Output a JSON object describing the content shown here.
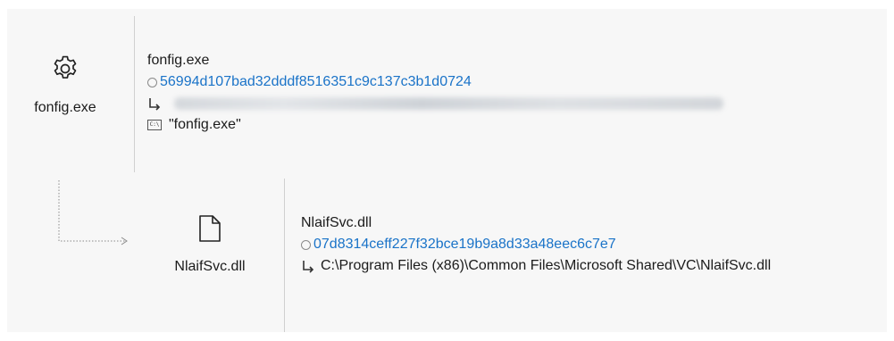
{
  "process": {
    "icon": "gear-icon",
    "label": "fonfig.exe",
    "name": "fonfig.exe",
    "hash": "56994d107bad32dddf8516351c9c137c3b1d0724",
    "command_line": "\"fonfig.exe\""
  },
  "loaded_file": {
    "icon": "file-icon",
    "label": "NlaifSvc.dll",
    "name": "NlaifSvc.dll",
    "hash": "07d8314ceff227f32bce19b9a8d33a48eec6c7e7",
    "path": "C:\\Program Files (x86)\\Common Files\\Microsoft Shared\\VC\\NlaifSvc.dll"
  },
  "colors": {
    "hash_link": "#1a73c8",
    "panel_bg": "#f7f7f7",
    "divider": "#d0d0d0"
  }
}
